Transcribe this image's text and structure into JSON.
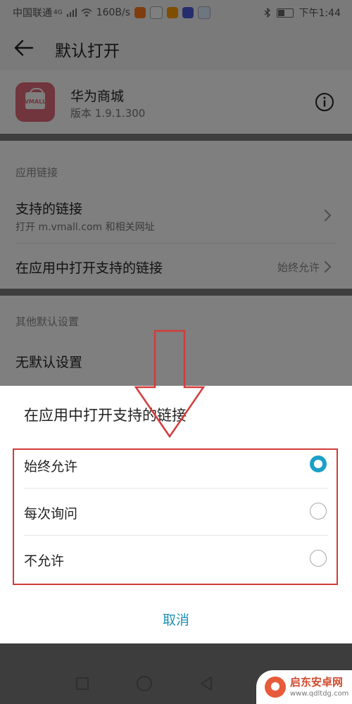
{
  "status_bar": {
    "carrier": "中国联通",
    "network_type": "4G",
    "speed": "160B/s",
    "time": "下午1:44"
  },
  "header": {
    "title": "默认打开"
  },
  "app": {
    "name": "华为商城",
    "version": "版本 1.9.1.300",
    "icon_text": "VMALL",
    "icon_color": "#e16b7a"
  },
  "app_links": {
    "section_label": "应用链接",
    "supported_links_title": "支持的链接",
    "supported_links_subtitle": "打开 m.vmall.com 和相关网址",
    "open_in_app_title": "在应用中打开支持的链接",
    "open_in_app_value": "始终允许"
  },
  "other_defaults": {
    "section_label": "其他默认设置",
    "no_default_label": "无默认设置"
  },
  "dialog": {
    "title": "在应用中打开支持的链接",
    "options": [
      {
        "label": "始终允许",
        "selected": true
      },
      {
        "label": "每次询问",
        "selected": false
      },
      {
        "label": "不允许",
        "selected": false
      }
    ],
    "cancel_label": "取消",
    "accent_color": "#1ba0c6"
  },
  "annotation": {
    "color": "#d23b3b"
  },
  "watermark": {
    "name": "启东安卓网",
    "url": "www.qdltdg.com"
  }
}
